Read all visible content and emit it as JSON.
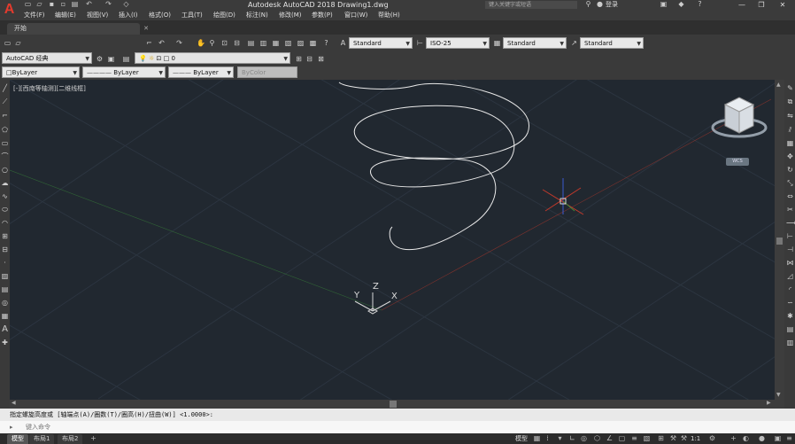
{
  "title_bar": {
    "app_logo": "A",
    "window_title": "Autodesk AutoCAD 2018    Drawing1.dwg",
    "search_placeholder": "键入关键字或短语",
    "user_label": "登录",
    "minimize": "—",
    "restore": "❐",
    "close": "✕"
  },
  "menu": {
    "items": [
      "文件(F)",
      "编辑(E)",
      "视图(V)",
      "插入(I)",
      "格式(O)",
      "工具(T)",
      "绘图(D)",
      "标注(N)",
      "修改(M)",
      "参数(P)",
      "窗口(W)",
      "帮助(H)"
    ]
  },
  "tabs": {
    "start_label": "开始",
    "close_glyph": "✕"
  },
  "toolbar_styles": {
    "text_style": "Standard",
    "dim_style": "ISO-25",
    "table_style": "Standard",
    "multileader_style": "Standard"
  },
  "workspace": {
    "name": "AutoCAD 经典",
    "layer": "0"
  },
  "properties": {
    "color": "ByLayer",
    "linetype": "ByLayer",
    "lineweight": "ByLayer",
    "plotstyle": "ByColor"
  },
  "viewport": {
    "label": "[-][西南等轴测][二维线框]",
    "wcs": "WCS",
    "ucs_x": "X",
    "ucs_y": "Y",
    "ucs_z": "Z"
  },
  "command": {
    "history": "指定螺旋高度或 [轴端点(A)/圈数(T)/圈高(H)/扭曲(W)] <1.0000>:",
    "placeholder": "键入命令"
  },
  "status": {
    "tabs": [
      "模型",
      "布局1",
      "布局2"
    ],
    "add_tab": "+",
    "model": "模型",
    "scale": "1:1"
  },
  "colors": {
    "canvas_bg": "#212830",
    "helix": "#e8e8e8",
    "ucs_x_axis": "#c0392b",
    "ucs_y_axis": "#3a8a3a",
    "ucs_z_axis": "#3a5ad0",
    "logo_red": "#e23b2e"
  }
}
